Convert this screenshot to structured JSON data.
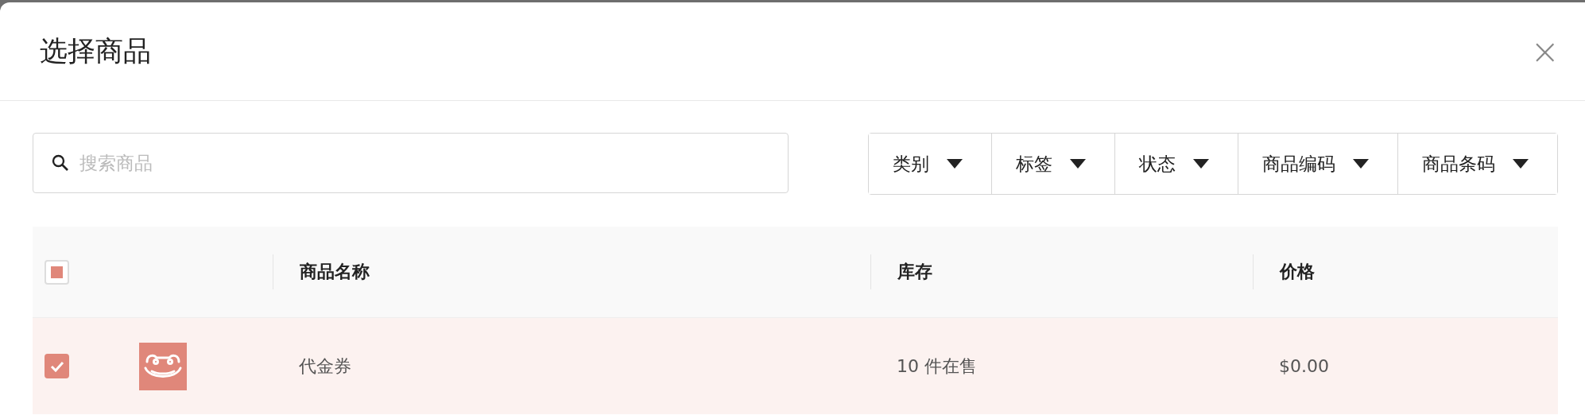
{
  "dialog": {
    "title": "选择商品",
    "close": "×"
  },
  "search": {
    "placeholder": "搜索商品"
  },
  "filters": [
    {
      "label": "类别"
    },
    {
      "label": "标签"
    },
    {
      "label": "状态"
    },
    {
      "label": "商品编码"
    },
    {
      "label": "商品条码"
    }
  ],
  "table": {
    "select_all": {
      "indeterminate": true
    },
    "columns": [
      "商品名称",
      "库存",
      "价格"
    ],
    "rows": [
      {
        "selected": true,
        "name": "代金券",
        "stock": "10 件在售",
        "price": "$0.00"
      }
    ]
  }
}
